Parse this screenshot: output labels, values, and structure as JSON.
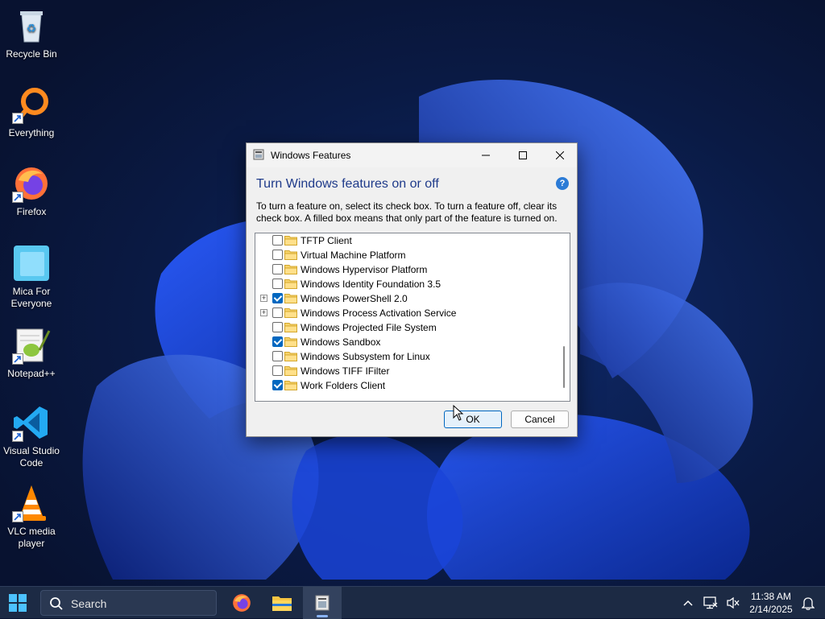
{
  "desktop": {
    "icons": [
      {
        "label": "Recycle Bin"
      },
      {
        "label": "Everything"
      },
      {
        "label": "Firefox"
      },
      {
        "label": "Mica For Everyone"
      },
      {
        "label": "Notepad++"
      },
      {
        "label": "Visual Studio Code"
      },
      {
        "label": "VLC media player"
      }
    ]
  },
  "dialog": {
    "title": "Windows Features",
    "heading": "Turn Windows features on or off",
    "help_label": "?",
    "description": "To turn a feature on, select its check box. To turn a feature off, clear its check box. A filled box means that only part of the feature is turned on.",
    "features": [
      {
        "label": "TFTP Client",
        "checked": false,
        "expandable": false
      },
      {
        "label": "Virtual Machine Platform",
        "checked": false,
        "expandable": false
      },
      {
        "label": "Windows Hypervisor Platform",
        "checked": false,
        "expandable": false
      },
      {
        "label": "Windows Identity Foundation 3.5",
        "checked": false,
        "expandable": false
      },
      {
        "label": "Windows PowerShell 2.0",
        "checked": true,
        "expandable": true
      },
      {
        "label": "Windows Process Activation Service",
        "checked": false,
        "expandable": true
      },
      {
        "label": "Windows Projected File System",
        "checked": false,
        "expandable": false
      },
      {
        "label": "Windows Sandbox",
        "checked": true,
        "expandable": false
      },
      {
        "label": "Windows Subsystem for Linux",
        "checked": false,
        "expandable": false
      },
      {
        "label": "Windows TIFF IFilter",
        "checked": false,
        "expandable": false
      },
      {
        "label": "Work Folders Client",
        "checked": true,
        "expandable": false
      }
    ],
    "ok_label": "OK",
    "cancel_label": "Cancel"
  },
  "taskbar": {
    "search_placeholder": "Search",
    "apps": [
      "firefox-icon",
      "file-explorer-icon",
      "windows-features-icon"
    ],
    "time": "11:38 AM",
    "date": "2/14/2025"
  },
  "colors": {
    "accent": "#0067c0",
    "heading": "#1e3a8a",
    "taskbar": "#1c2a44"
  }
}
